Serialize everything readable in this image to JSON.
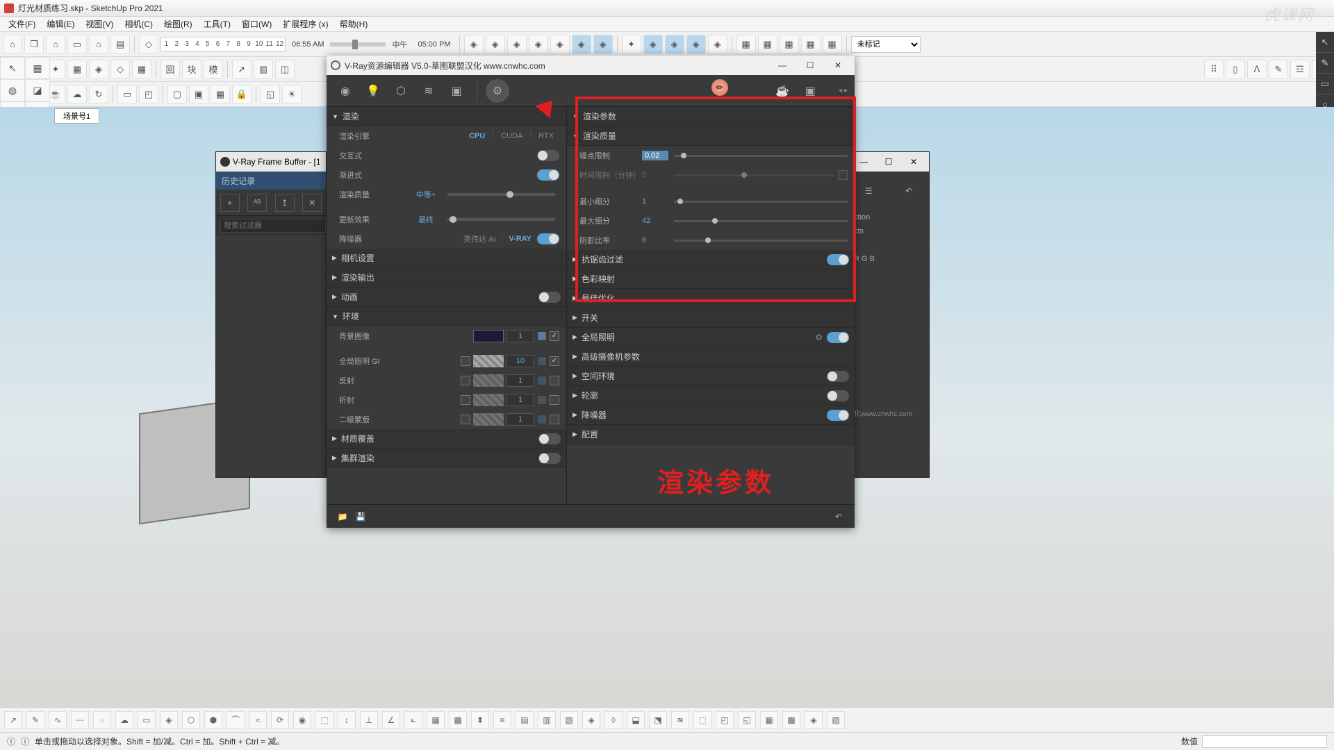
{
  "window": {
    "title": "灯光材质练习.skp - SketchUp Pro 2021"
  },
  "menu": [
    "文件(F)",
    "编辑(E)",
    "视图(V)",
    "相机(C)",
    "绘图(R)",
    "工具(T)",
    "窗口(W)",
    "扩展程序 (x)",
    "帮助(H)"
  ],
  "timebar": {
    "ticks": [
      "1",
      "2",
      "3",
      "4",
      "5",
      "6",
      "7",
      "8",
      "9",
      "10",
      "11",
      "12"
    ],
    "t1": "06:55 AM",
    "mid": "中午",
    "t2": "05:00 PM"
  },
  "tag_select": "未标记",
  "scene_tab": "场景号1",
  "status": {
    "hint": "单击或拖动以选择对象。Shift = 加/减。Ctrl = 加。Shift + Ctrl = 减。",
    "measure_label": "数值"
  },
  "vfb": {
    "title": "V-Ray Frame Buffer - [1",
    "history": "历史记录",
    "search_ph": "搜索过滤器"
  },
  "vae": {
    "title": "V-Ray资源编辑器 V5.0-草图联盟汉化 www.cnwhc.com",
    "left": {
      "render_head": "渲染",
      "engine_label": "渲染引擎",
      "engines": [
        "CPU",
        "CUDA",
        "RTX"
      ],
      "interactive": "交互式",
      "progressive": "渐进式",
      "quality_label": "渲染质量",
      "quality_val": "中等+",
      "update_label": "更新效果",
      "update_val": "最终",
      "denoiser_label": "降噪器",
      "denoiser_a": "英伟达 AI",
      "denoiser_b": "V-RAY",
      "camera": "相机设置",
      "output": "渲染输出",
      "anim": "动画",
      "env": "环境",
      "bg_label": "背景图像",
      "bg_val": "1",
      "gi_label": "全局照明 GI",
      "gi_val": "10",
      "refl_label": "反射",
      "refl_val": "1",
      "refr_label": "折射",
      "refr_val": "1",
      "mask_label": "二级蒙版",
      "mask_val": "1",
      "mat_over": "材质覆盖",
      "swarm": "集群渲染"
    },
    "right": {
      "params_head": "渲染参数",
      "quality_head": "渲染质量",
      "noise_label": "噪点限制",
      "noise_val": "0.02",
      "time_label": "时间限制（分钟）",
      "time_val": "5",
      "minsub_label": "最小细分",
      "minsub_val": "1",
      "maxsub_label": "最大细分",
      "maxsub_val": "42",
      "shadow_label": "阴影比率",
      "shadow_val": "6",
      "aa": "抗锯齿过滤",
      "color": "色彩映射",
      "opt": "最佳优化",
      "switch": "开关",
      "gi": "全局照明",
      "advcam": "高级摄像机参数",
      "spaceenv": "空间环境",
      "contour": "轮廓",
      "denoise": "降噪器",
      "config": "配置"
    }
  },
  "hidden_panel": {
    "lines": [
      "ction",
      "cts",
      "R G B",
      "化www.cnwhc.com"
    ]
  },
  "annot": {
    "big": "渲染参数"
  },
  "watermark": "虎课网"
}
